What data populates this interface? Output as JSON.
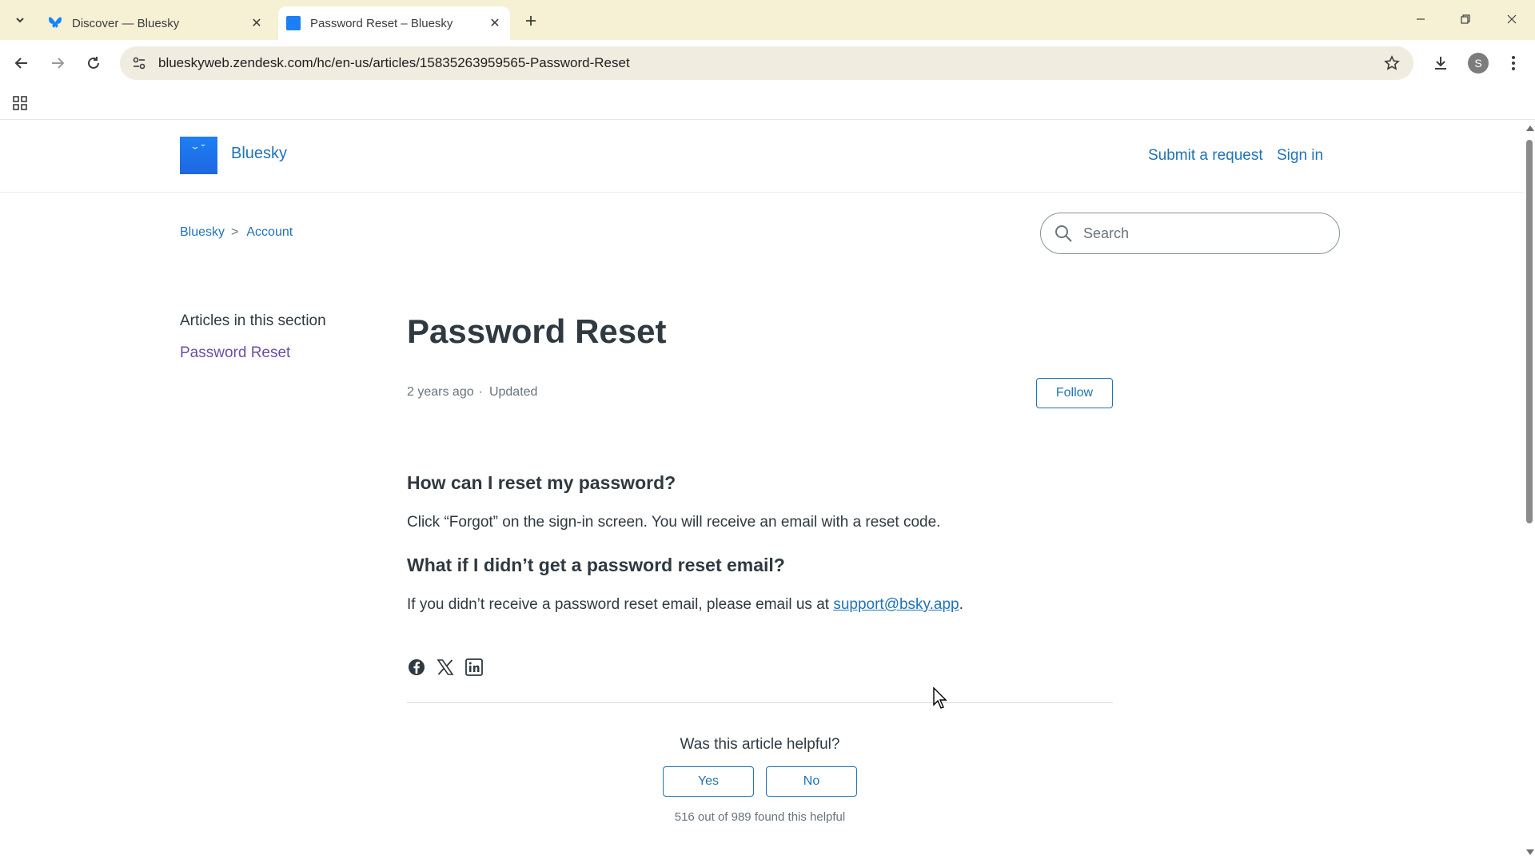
{
  "browser": {
    "tabs": [
      {
        "title": "Discover — Bluesky",
        "active": false
      },
      {
        "title": "Password Reset – Bluesky",
        "active": true
      }
    ],
    "url": "blueskyweb.zendesk.com/hc/en-us/articles/15835263959565-Password-Reset",
    "profile_initial": "S"
  },
  "header": {
    "brand": "Bluesky",
    "submit_request": "Submit a request",
    "sign_in": "Sign in"
  },
  "breadcrumb": {
    "items": [
      "Bluesky",
      "Account"
    ],
    "separator": ">"
  },
  "search": {
    "placeholder": "Search"
  },
  "sidebar": {
    "heading": "Articles in this section",
    "links": [
      "Password Reset"
    ]
  },
  "article": {
    "title": "Password Reset",
    "meta_time": "2 years ago",
    "meta_dot": "·",
    "meta_status": "Updated",
    "follow_label": "Follow",
    "sections": [
      {
        "heading": "How can I reset my password?",
        "body": "Click “Forgot” on the sign-in screen. You will receive an email with a reset code."
      },
      {
        "heading": "What if I didn’t get a password reset email?",
        "body_prefix": "If you didn’t receive a password reset email, please email us at ",
        "email": "support@bsky.app",
        "body_suffix": "."
      }
    ],
    "share_icons": [
      "facebook-icon",
      "x-icon",
      "linkedin-icon"
    ]
  },
  "feedback": {
    "question": "Was this article helpful?",
    "yes_label": "Yes",
    "no_label": "No",
    "count_text": "516 out of 989 found this helpful"
  },
  "colors": {
    "accent": "#1f73b7",
    "visited": "#6a4ea8",
    "tabbar": "#f6f0d4",
    "logo": "#1d7ff5"
  }
}
